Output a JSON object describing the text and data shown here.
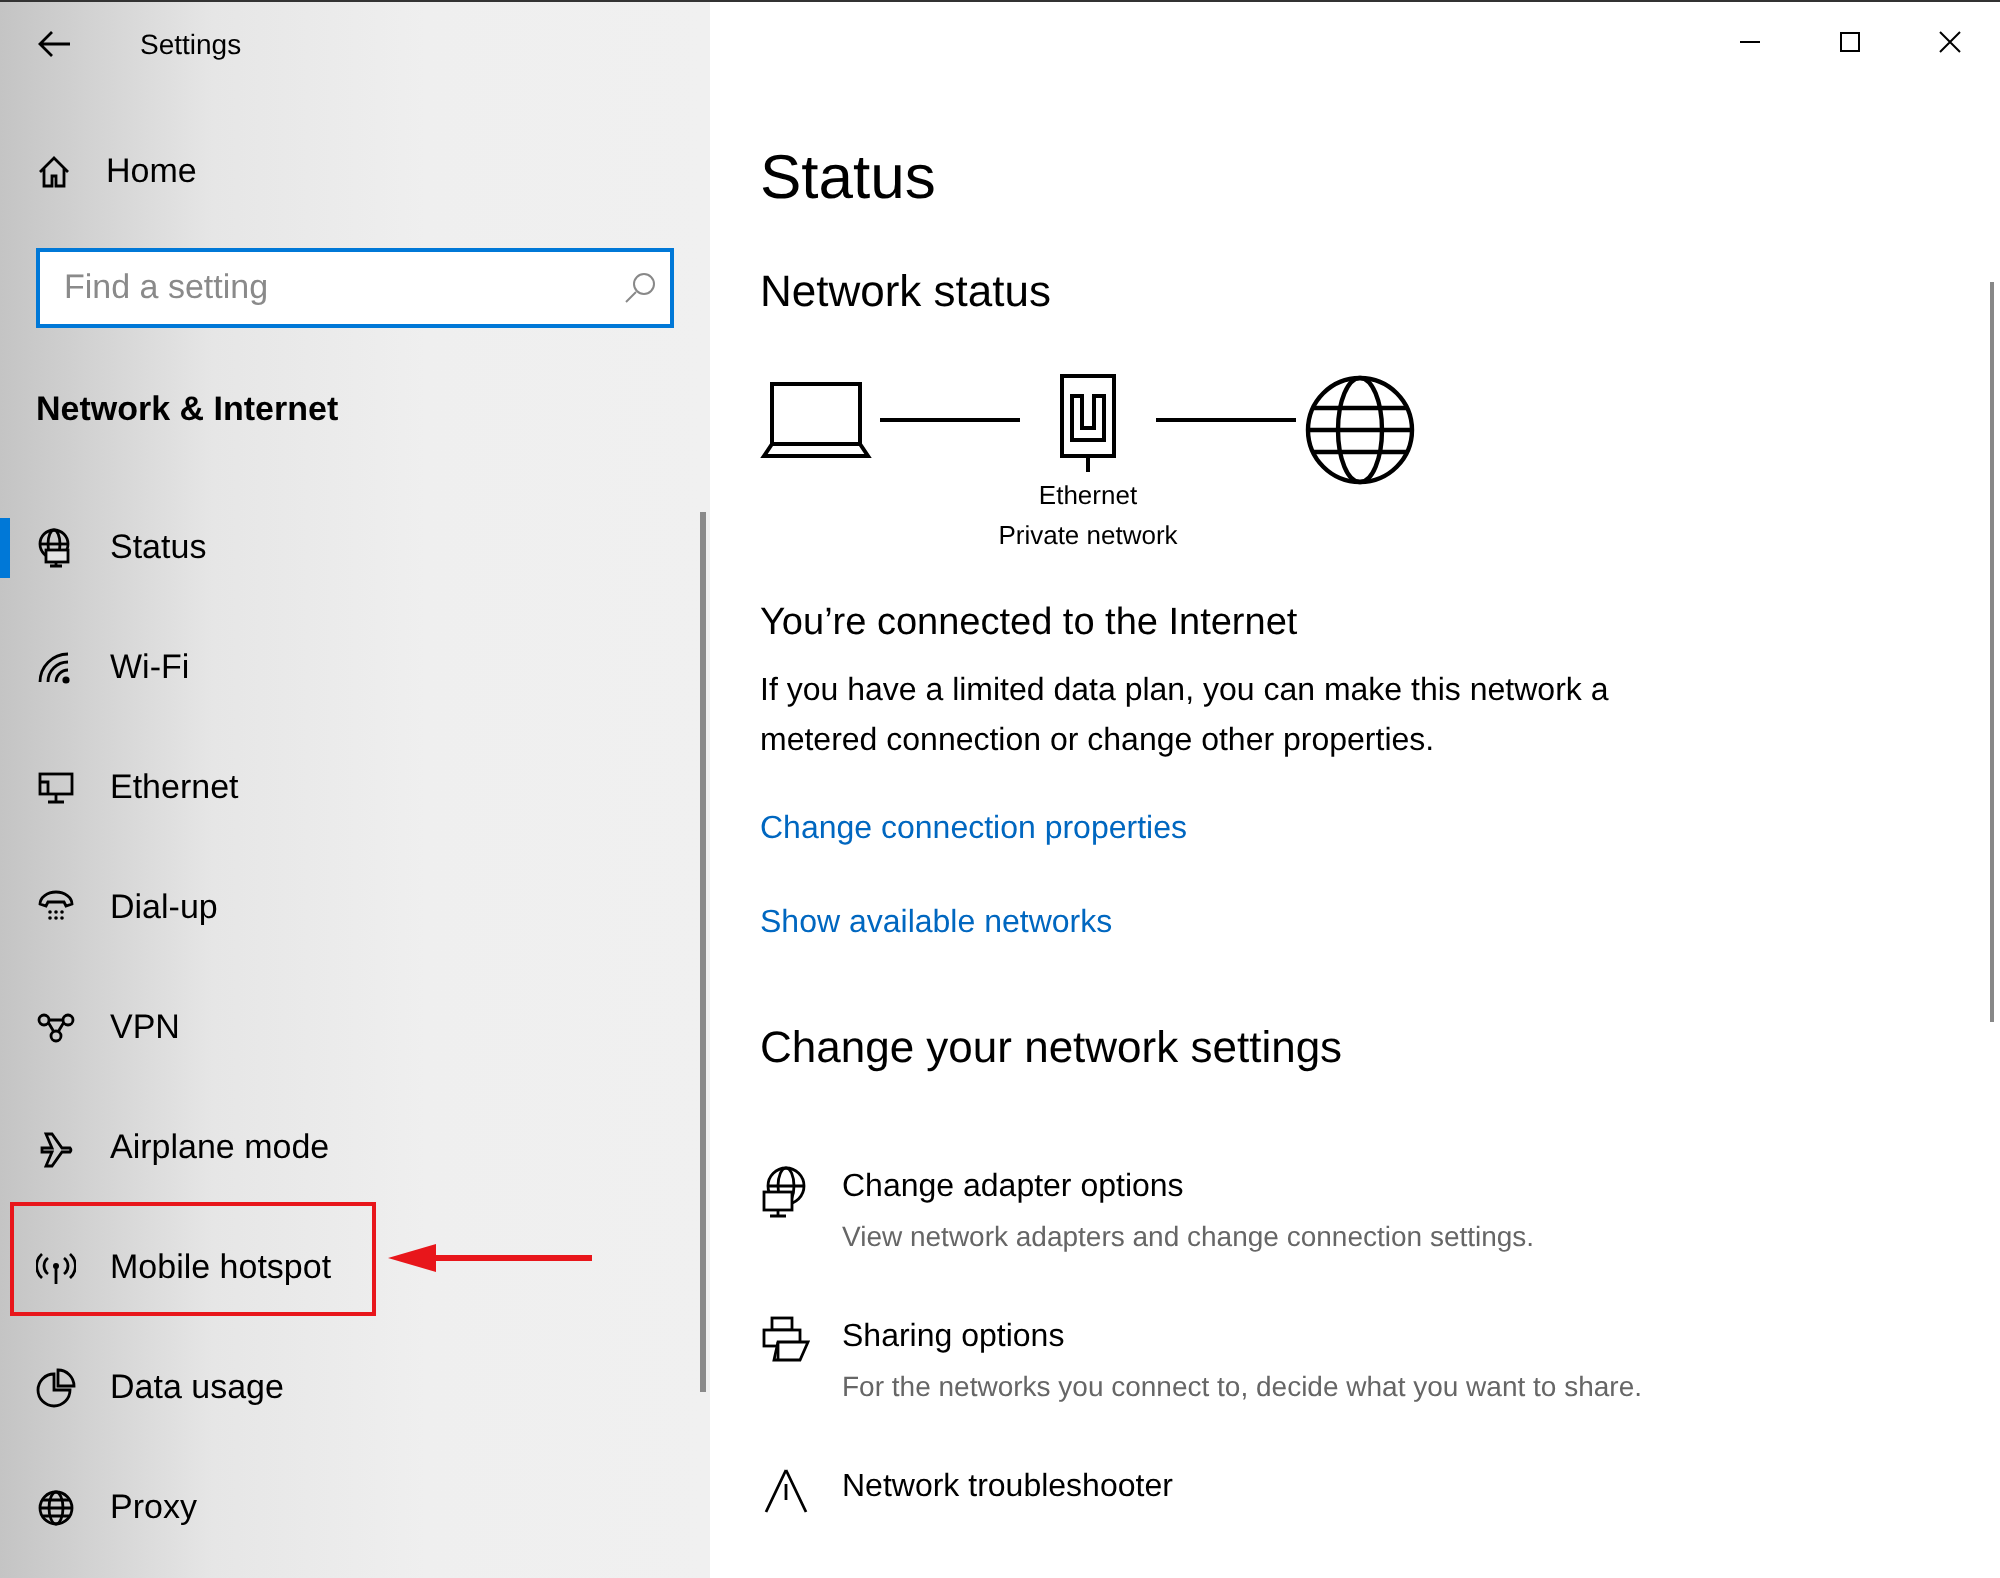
{
  "window": {
    "title": "Settings"
  },
  "sidebar": {
    "home": "Home",
    "search": {
      "placeholder": "Find a setting"
    },
    "section": "Network & Internet",
    "items": [
      {
        "label": "Status",
        "selected": true,
        "highlighted": false
      },
      {
        "label": "Wi-Fi",
        "selected": false,
        "highlighted": false
      },
      {
        "label": "Ethernet",
        "selected": false,
        "highlighted": false
      },
      {
        "label": "Dial-up",
        "selected": false,
        "highlighted": false
      },
      {
        "label": "VPN",
        "selected": false,
        "highlighted": false
      },
      {
        "label": "Airplane mode",
        "selected": false,
        "highlighted": false
      },
      {
        "label": "Mobile hotspot",
        "selected": false,
        "highlighted": true
      },
      {
        "label": "Data usage",
        "selected": false,
        "highlighted": false
      },
      {
        "label": "Proxy",
        "selected": false,
        "highlighted": false
      }
    ]
  },
  "content": {
    "title": "Status",
    "network_status": {
      "heading": "Network status",
      "adapter_name": "Ethernet",
      "network_type": "Private network"
    },
    "connection": {
      "heading": "You’re connected to the Internet",
      "description": "If you have a limited data plan, you can make this network a metered connection or change other properties.",
      "links": [
        "Change connection properties",
        "Show available networks"
      ]
    },
    "change_settings": {
      "heading": "Change your network settings",
      "items": [
        {
          "title": "Change adapter options",
          "description": "View network adapters and change connection settings."
        },
        {
          "title": "Sharing options",
          "description": "For the networks you connect to, decide what you want to share."
        },
        {
          "title": "Network troubleshooter"
        }
      ]
    }
  }
}
